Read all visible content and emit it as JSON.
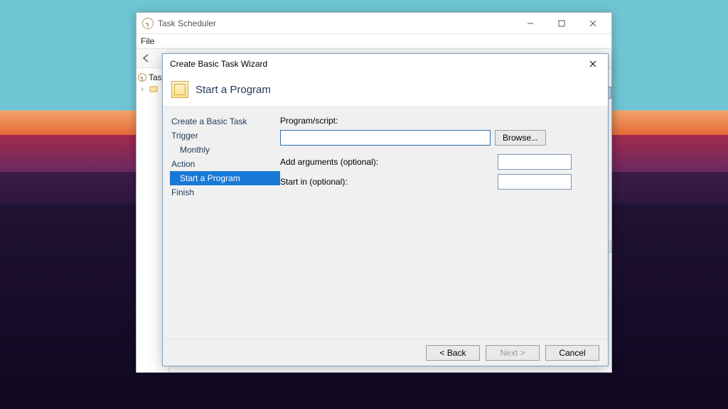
{
  "taskScheduler": {
    "title": "Task Scheduler",
    "menubar": {
      "file": "File"
    },
    "tree": {
      "root": "Task Scheduler (Local)",
      "rootShort": "Task"
    }
  },
  "wizard": {
    "title": "Create Basic Task Wizard",
    "heading": "Start a Program",
    "sidebar": {
      "createBasic": "Create a Basic Task",
      "trigger": "Trigger",
      "triggerSub": "Monthly",
      "action": "Action",
      "actionSub": "Start a Program",
      "finish": "Finish"
    },
    "content": {
      "programLabel": "Program/script:",
      "programValue": "",
      "browse": "Browse...",
      "argsLabel": "Add arguments (optional):",
      "argsValue": "",
      "startInLabel": "Start in (optional):",
      "startInValue": ""
    },
    "footer": {
      "back": "< Back",
      "next": "Next >",
      "cancel": "Cancel"
    }
  }
}
